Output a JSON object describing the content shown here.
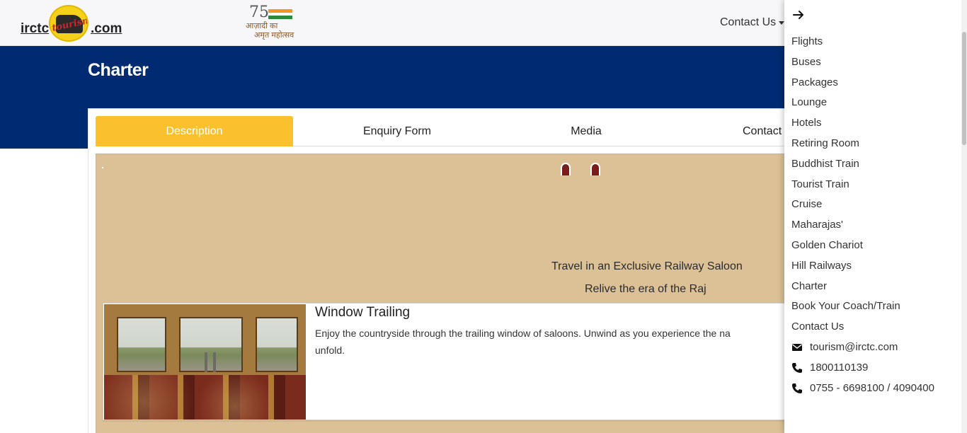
{
  "header": {
    "logo": {
      "left": "irctc",
      "badge": "tourism",
      "right": ".com"
    },
    "amrit": {
      "number": "75",
      "line1": "आज़ादी का",
      "line2": "अमृत महोत्सव"
    },
    "contact_label": "Contact Us"
  },
  "page": {
    "title": "Charter"
  },
  "tabs": [
    {
      "label": "Description",
      "active": true
    },
    {
      "label": "Enquiry Form",
      "active": false
    },
    {
      "label": "Media",
      "active": false
    },
    {
      "label": "Contact",
      "active": false
    }
  ],
  "content": {
    "tagline1": "Travel in an Exclusive Railway Saloon",
    "tagline2": "Relive the era of the Raj",
    "feature": {
      "title": "Window Trailing",
      "text": "Enjoy the countryside through the trailing window of saloons. Unwind as you experience the na",
      "text_cont": "unfold."
    }
  },
  "side_menu": {
    "items": [
      "Flights",
      "Buses",
      "Packages",
      "Lounge",
      "Hotels",
      "Retiring Room",
      "Buddhist Train",
      "Tourist Train",
      "Cruise",
      "Maharajas'",
      "Golden Chariot",
      "Hill Railways",
      "Charter",
      "Book Your Coach/Train",
      "Contact Us"
    ],
    "email": "tourism@irctc.com",
    "phone1": "1800110139",
    "phone2": "0755 - 6698100 / 4090400"
  },
  "colors": {
    "brand_blue": "#002b73",
    "accent_yellow": "#fbc02d",
    "content_bg": "#dcc197"
  }
}
